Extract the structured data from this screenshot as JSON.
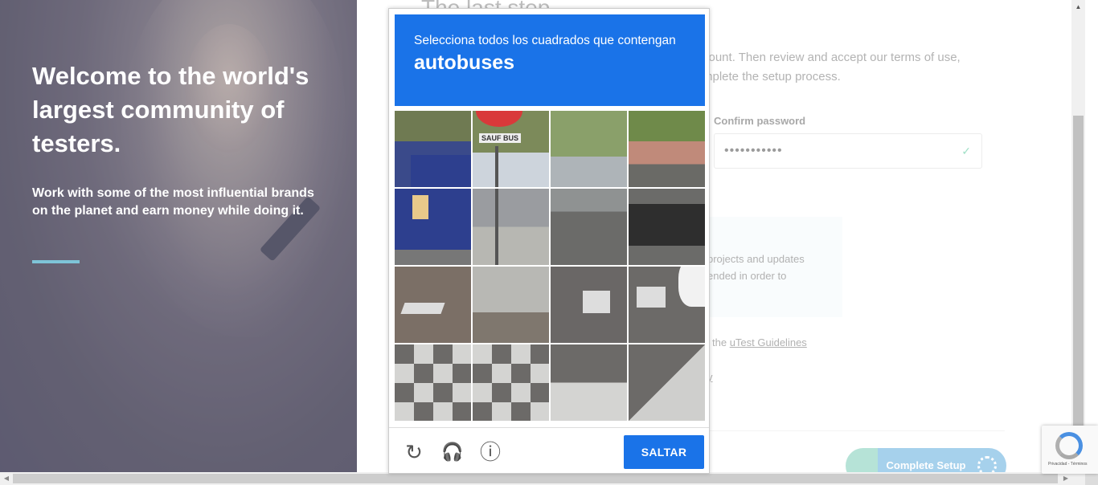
{
  "hero": {
    "title": "Welcome to the world's largest community of testers.",
    "subtitle": "Work with some of the most influential brands on the planet and earn money while doing it."
  },
  "form": {
    "title": "The last step",
    "description": "count. Then review and accept our terms of use, mplete the setup process.",
    "confirm_password_label": "Confirm password",
    "confirm_password_value": "•••••••••••",
    "info_text": "projects and updates ended in order to",
    "guidelines_prefix": "the ",
    "guidelines_link": "uTest Guidelines",
    "privacy_link": "y",
    "complete_button": "Complete Setup"
  },
  "captcha": {
    "instruction": "Selecciona todos los cuadrados que contengan",
    "target": "autobuses",
    "sign_text": "SAUF BUS",
    "skip_button": "SALTAR",
    "icons": [
      "reload-icon",
      "headphones-icon",
      "info-icon"
    ]
  },
  "badge": {
    "text": "Privacidad - Términos"
  },
  "colors": {
    "captcha_blue": "#1a73e8",
    "accent_line": "#7ec4d8",
    "check_green": "#6fcfa9"
  }
}
